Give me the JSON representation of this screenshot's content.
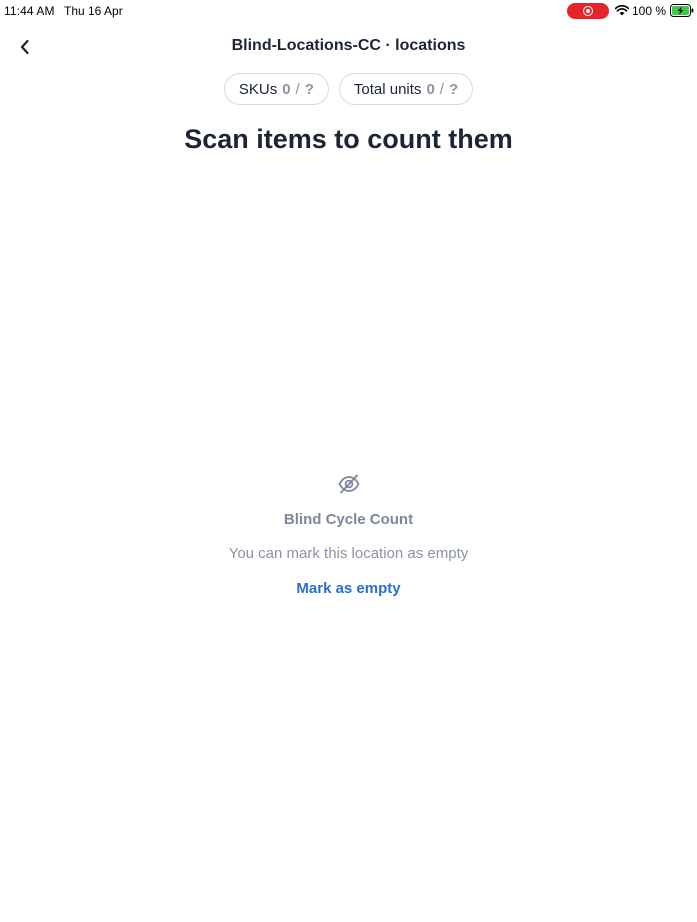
{
  "status_bar": {
    "time": "11:44 AM",
    "date": "Thu 16 Apr",
    "battery_percent": "100 %",
    "recording_icon": "screen-recording-icon",
    "wifi_icon": "wifi-icon",
    "battery_icon": "battery-charging-icon",
    "recording_color": "#e5252b",
    "battery_color": "#3ec94a"
  },
  "header": {
    "back_icon": "chevron-left-icon",
    "title": "Blind-Locations-CC · locations"
  },
  "stats": {
    "skus": {
      "label": "SKUs",
      "counted": "0",
      "separator": "/",
      "expected": "?"
    },
    "units": {
      "label": "Total units",
      "counted": "0",
      "separator": "/",
      "expected": "?"
    }
  },
  "main": {
    "heading": "Scan items to count them"
  },
  "empty_state": {
    "icon": "eye-off-icon",
    "title": "Blind Cycle Count",
    "description": "You can mark this location as empty",
    "action_label": "Mark as empty",
    "action_color": "#2b6fd1"
  }
}
